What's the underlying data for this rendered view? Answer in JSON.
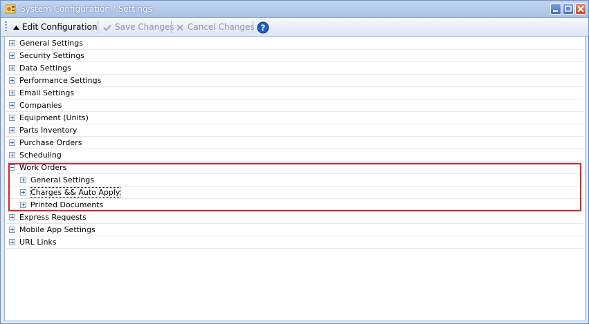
{
  "window": {
    "title": "System Configuration / Settings",
    "icon": "settings-app-icon",
    "buttons": [
      "minimize-icon",
      "maximize-icon",
      "close-icon"
    ]
  },
  "toolbar": {
    "edit_label": "Edit Configuration",
    "save_label": "Save Changes",
    "cancel_label": "Cancel Changes",
    "help_icon": "help-icon",
    "save_enabled": false,
    "cancel_enabled": false
  },
  "tree": {
    "items": [
      {
        "label": "General Settings",
        "expanded": false
      },
      {
        "label": "Security Settings",
        "expanded": false
      },
      {
        "label": "Data Settings",
        "expanded": false
      },
      {
        "label": "Performance Settings",
        "expanded": false
      },
      {
        "label": "Email Settings",
        "expanded": false
      },
      {
        "label": "Companies",
        "expanded": false
      },
      {
        "label": "Equipment (Units)",
        "expanded": false
      },
      {
        "label": "Parts Inventory",
        "expanded": false
      },
      {
        "label": "Purchase Orders",
        "expanded": false
      },
      {
        "label": "Scheduling",
        "expanded": false
      },
      {
        "label": "Work Orders",
        "expanded": true,
        "children": [
          {
            "label": "General Settings",
            "expanded": false
          },
          {
            "label": "Charges && Auto Apply",
            "expanded": false,
            "focused": true
          },
          {
            "label": "Printed Documents",
            "expanded": false
          }
        ]
      },
      {
        "label": "Express Requests",
        "expanded": false
      },
      {
        "label": "Mobile App Settings",
        "expanded": false
      },
      {
        "label": "URL Links",
        "expanded": false
      }
    ]
  },
  "colors": {
    "highlight_border": "#e02020",
    "help_icon": "#1f5fc4"
  }
}
